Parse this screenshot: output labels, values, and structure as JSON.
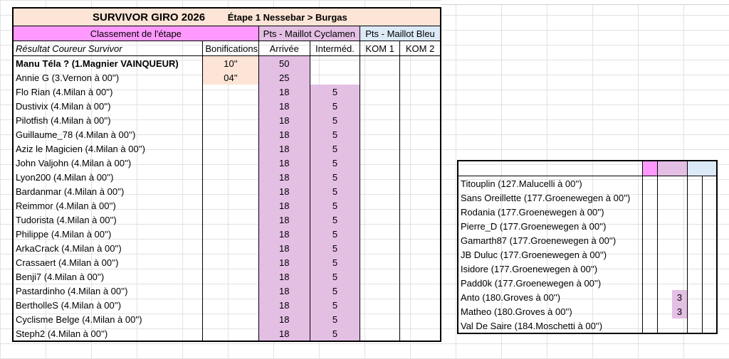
{
  "sheet": {
    "title": "SURVIVOR GIRO 2026",
    "stage": "Étape 1  Nessebar > Burgas",
    "section_ranking": "Classement de l'étape",
    "section_cyclamen": "Pts - Maillot Cyclamen",
    "section_blue": "Pts - Maillot Bleu",
    "col_result": "Résultat  Coureur Survivor",
    "col_bonus": "Bonifications",
    "col_arrival": "Arrivée",
    "col_intermediate": "Interméd.",
    "col_kom1": "KOM 1",
    "col_kom2": "KOM 2",
    "rows": [
      {
        "name": "Manu Téla ? (1.Magnier VAINQUEUR)",
        "bonus": "10''",
        "arrival": "50",
        "inter": ""
      },
      {
        "name": "Annie G (3.Vernon à 00'')",
        "bonus": "04''",
        "arrival": "25",
        "inter": ""
      },
      {
        "name": "Flo Rian (4.Milan à 00'')",
        "bonus": "",
        "arrival": "18",
        "inter": "5"
      },
      {
        "name": "Dustivix (4.Milan à 00'')",
        "bonus": "",
        "arrival": "18",
        "inter": "5"
      },
      {
        "name": "Pilotfish (4.Milan à 00'')",
        "bonus": "",
        "arrival": "18",
        "inter": "5"
      },
      {
        "name": "Guillaume_78 (4.Milan à 00'')",
        "bonus": "",
        "arrival": "18",
        "inter": "5"
      },
      {
        "name": "Aziz le Magicien (4.Milan à 00'')",
        "bonus": "",
        "arrival": "18",
        "inter": "5"
      },
      {
        "name": "John Valjohn (4.Milan à 00'')",
        "bonus": "",
        "arrival": "18",
        "inter": "5"
      },
      {
        "name": "Lyon200 (4.Milan à 00'')",
        "bonus": "",
        "arrival": "18",
        "inter": "5"
      },
      {
        "name": "Bardanmar (4.Milan à 00'')",
        "bonus": "",
        "arrival": "18",
        "inter": "5"
      },
      {
        "name": "Reimmor (4.Milan à 00'')",
        "bonus": "",
        "arrival": "18",
        "inter": "5"
      },
      {
        "name": "Tudorista (4.Milan à 00'')",
        "bonus": "",
        "arrival": "18",
        "inter": "5"
      },
      {
        "name": "Philippe (4.Milan à 00'')",
        "bonus": "",
        "arrival": "18",
        "inter": "5"
      },
      {
        "name": "ArkaCrack (4.Milan à 00'')",
        "bonus": "",
        "arrival": "18",
        "inter": "5"
      },
      {
        "name": "Crassaert (4.Milan à 00'')",
        "bonus": "",
        "arrival": "18",
        "inter": "5"
      },
      {
        "name": "Benji7 (4.Milan à 00'')",
        "bonus": "",
        "arrival": "18",
        "inter": "5"
      },
      {
        "name": "Pastardinho (4.Milan à 00'')",
        "bonus": "",
        "arrival": "18",
        "inter": "5"
      },
      {
        "name": "BertholleS (4.Milan à 00'')",
        "bonus": "",
        "arrival": "18",
        "inter": "5"
      },
      {
        "name": "Cyclisme Belge (4.Milan à 00'')",
        "bonus": "",
        "arrival": "18",
        "inter": "5"
      },
      {
        "name": "Steph2 (4.Milan à 00'')",
        "bonus": "",
        "arrival": "18",
        "inter": "5"
      }
    ],
    "side_rows": [
      {
        "name": "Titouplin (127.Malucelli à 00'')",
        "inter": ""
      },
      {
        "name": "Sans Oreillette (177.Groenewegen à 00'')",
        "inter": ""
      },
      {
        "name": "Rodania (177.Groenewegen à 00'')",
        "inter": ""
      },
      {
        "name": "Pierre_D (177.Groenewegen à 00'')",
        "inter": ""
      },
      {
        "name": "Gamarth87 (177.Groenewegen à 00'')",
        "inter": ""
      },
      {
        "name": "JB Duluc (177.Groenewegen à 00'')",
        "inter": ""
      },
      {
        "name": "Isidore (177.Groenewegen à 00'')",
        "inter": ""
      },
      {
        "name": "Padd0k (177.Groenewegen à 00'')",
        "inter": ""
      },
      {
        "name": "Anto (180.Groves à 00'')",
        "inter": "3"
      },
      {
        "name": "Matheo (180.Groves à 00'')",
        "inter": "3"
      },
      {
        "name": "Val De Saire (184.Moschetti à 00'')",
        "inter": ""
      }
    ]
  }
}
